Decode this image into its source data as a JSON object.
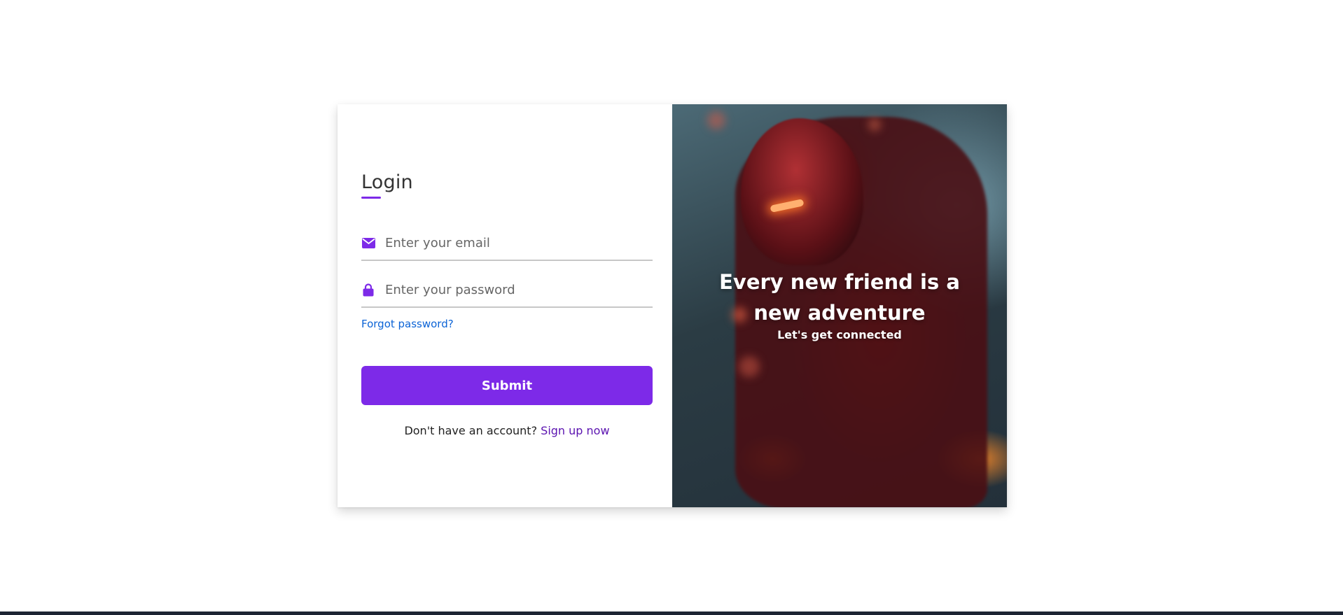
{
  "login": {
    "title": "Login",
    "email_placeholder": "Enter your email",
    "password_placeholder": "Enter your password",
    "forgot_label": "Forgot password?",
    "submit_label": "Submit",
    "signup_text": "Don't have an account?",
    "signup_link": "Sign up now"
  },
  "hero": {
    "headline": "Every new friend is a new adventure",
    "subline": "Let's get connected"
  },
  "icons": {
    "email": "envelope-icon",
    "password": "lock-icon"
  },
  "colors": {
    "accent": "#7d2ae8",
    "link": "#0b63d6",
    "signup_link": "#5b13b0"
  }
}
